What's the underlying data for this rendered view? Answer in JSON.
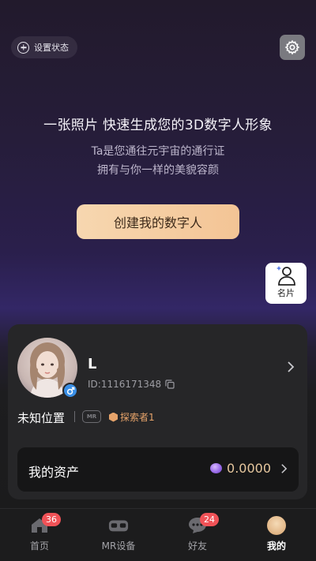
{
  "header": {
    "set_status_label": "设置状态"
  },
  "hero": {
    "title": "一张照片 快速生成您的3D数字人形象",
    "subtitle_line1": "Ta是您通往元宇宙的通行证",
    "subtitle_line2": "拥有与你一样的美貌容颜",
    "create_button": "创建我的数字人"
  },
  "side_card": {
    "label": "名片"
  },
  "profile": {
    "name": "L",
    "id_text": "ID:1116171348",
    "location": "未知位置",
    "mr_badge": "MR",
    "explorer_label": "探索者1",
    "assets_label": "我的资产",
    "assets_value": "0.0000"
  },
  "tabbar": {
    "tabs": [
      {
        "label": "首页",
        "badge": "36"
      },
      {
        "label": "MR设备",
        "badge": ""
      },
      {
        "label": "好友",
        "badge": "24"
      },
      {
        "label": "我的",
        "badge": ""
      }
    ]
  },
  "colors": {
    "accent_gold": "#f3c495",
    "badge_red": "#f05257",
    "gender_blue": "#3a8fe6",
    "explorer_orange": "#e6a36a"
  }
}
